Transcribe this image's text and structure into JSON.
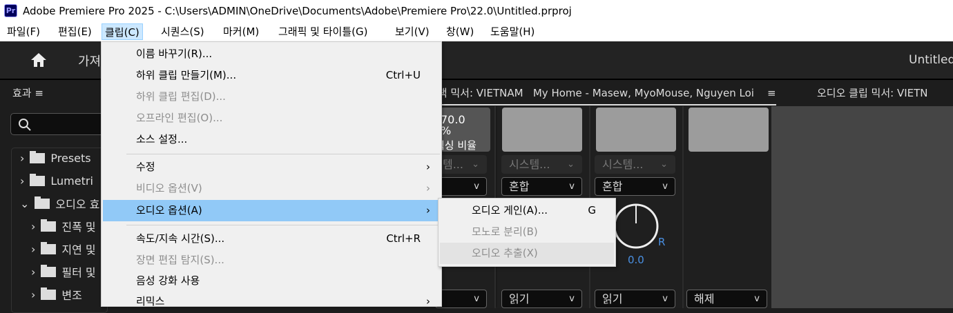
{
  "titlebar": {
    "app_icon": "Pr",
    "title": "Adobe Premiere Pro 2025 - C:\\Users\\ADMIN\\OneDrive\\Documents\\Adobe\\Premiere Pro\\22.0\\Untitled.prproj"
  },
  "menubar": [
    "파일(F)",
    "편집(E)",
    "클립(C)",
    "시퀀스(S)",
    "마커(M)",
    "그래픽 및 타이틀(G)",
    "보기(V)",
    "창(W)",
    "도움말(H)"
  ],
  "header": {
    "workspace_partial": "가져",
    "project": "Untitled"
  },
  "effects_panel": {
    "title": "효과",
    "menu_icon": "≡",
    "tree": [
      {
        "label": "Presets",
        "expanded": false,
        "level": 0
      },
      {
        "label": "Lumetri",
        "expanded": false,
        "level": 0
      },
      {
        "label": "오디오 효",
        "expanded": true,
        "level": 0
      },
      {
        "label": "진폭 및",
        "expanded": false,
        "level": 1
      },
      {
        "label": "지연 및",
        "expanded": false,
        "level": 1
      },
      {
        "label": "필터 및",
        "expanded": false,
        "level": 1
      },
      {
        "label": "변조",
        "expanded": false,
        "level": 1
      }
    ]
  },
  "mixer": {
    "tab1": "트랙 믹서: VIETNAM",
    "tab1_sequence": "My Home - Masew, MyoMouse, Nguyen Loi",
    "tab2": "오디오 클립 믹서: VIETN",
    "mix_value": "70.0",
    "mix_unit": "%",
    "mix_label": "믹싱 비율",
    "system_label": "시스템...",
    "system_label_partial": "템...",
    "blend": "혼합",
    "pan_right": "R",
    "pan_value": "0.0",
    "automation": [
      "읽기",
      "읽기",
      "해제"
    ]
  },
  "clip_menu": {
    "items": [
      {
        "label": "이름 바꾸기(R)...",
        "enabled": true
      },
      {
        "label": "하위 클립 만들기(M)...",
        "shortcut": "Ctrl+U",
        "enabled": true
      },
      {
        "label": "하위 클립 편집(D)...",
        "enabled": false
      },
      {
        "label": "오프라인 편집(O)...",
        "enabled": false
      },
      {
        "label": "소스 설정...",
        "enabled": true
      },
      {
        "label": "수정",
        "submenu": true,
        "enabled": true
      },
      {
        "label": "비디오 옵션(V)",
        "submenu": true,
        "enabled": false
      },
      {
        "label": "오디오 옵션(A)",
        "submenu": true,
        "enabled": true,
        "highlighted": true
      },
      {
        "label": "속도/지속 시간(S)...",
        "shortcut": "Ctrl+R",
        "enabled": true
      },
      {
        "label": "장면 편집 탐지(S)...",
        "enabled": false
      },
      {
        "label": "음성 강화 사용",
        "enabled": true
      },
      {
        "label": "리믹스",
        "submenu": true,
        "enabled": true
      }
    ]
  },
  "audio_submenu": {
    "items": [
      {
        "label": "오디오 게인(A)...",
        "shortcut": "G",
        "enabled": true
      },
      {
        "label": "모노로 분리(B)",
        "enabled": false
      },
      {
        "label": "오디오 추출(X)",
        "enabled": false,
        "hovered": true
      }
    ]
  }
}
